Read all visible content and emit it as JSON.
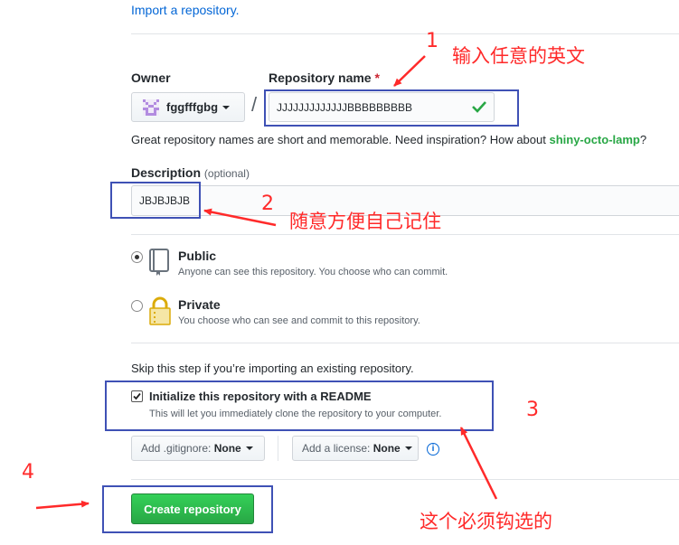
{
  "import_link": "Import a repository.",
  "owner": {
    "label": "Owner",
    "name": "fggfffgbg"
  },
  "separator": "/",
  "repo_name": {
    "label": "Repository name",
    "required_mark": "*",
    "value": "JJJJJJJJJJJJJBBBBBBBBB"
  },
  "name_hint": {
    "prefix": "Great repository names are short and memorable. Need inspiration? How about ",
    "suggestion": "shiny-octo-lamp",
    "suffix": "?"
  },
  "description": {
    "label": "Description",
    "optional": "(optional)",
    "value": "JBJBJBJB"
  },
  "visibility": {
    "public": {
      "title": "Public",
      "note": "Anyone can see this repository. You choose who can commit.",
      "selected": true
    },
    "private": {
      "title": "Private",
      "note": "You choose who can see and commit to this repository.",
      "selected": false
    }
  },
  "skip_note": "Skip this step if you’re importing an existing repository.",
  "readme": {
    "label": "Initialize this repository with a README",
    "note": "This will let you immediately clone the repository to your computer.",
    "checked": true
  },
  "gitignore": {
    "prefix": "Add .gitignore:",
    "value": "None"
  },
  "license": {
    "prefix": "Add a license:",
    "value": "None"
  },
  "info_icon": "i",
  "create_button": "Create repository",
  "annotations": {
    "n1": "1",
    "t1": "输入任意的英文",
    "n2": "2",
    "t2": "随意方便自己记住",
    "n3": "3",
    "t3": "这个必须钩选的",
    "n4": "4"
  },
  "colors": {
    "annotation_red": "#ff2a2a",
    "annotation_box": "#3f51b5",
    "create_green": "#28a745",
    "link_blue": "#0366d6"
  }
}
